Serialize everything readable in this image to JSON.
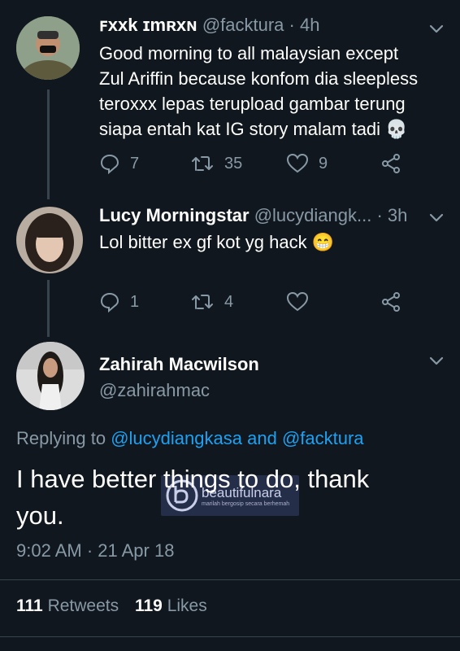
{
  "tweet1": {
    "display_name": "ꜰxxk ɪmʀxɴ",
    "handle": "@facktura",
    "time": "· 4h",
    "text_lines": [
      "Good morning to all malaysian except",
      "Zul Ariffin because konfom dia sleepless",
      "teroxxx lepas terupload gambar terung",
      "siapa entah kat IG story malam tadi 💀"
    ],
    "replies": "7",
    "retweets": "35",
    "likes": "9"
  },
  "tweet2": {
    "display_name": "Lucy Morningstar",
    "handle": "@lucydiangk...",
    "time": "· 3h",
    "text": "Lol bitter ex gf kot yg hack 😁",
    "replies": "1",
    "retweets": "4"
  },
  "main_tweet": {
    "display_name": "Zahirah Macwilson",
    "handle": "@zahirahmac",
    "replying_prefix": "Replying to",
    "reply_to_1": "@lucydiangkasa",
    "reply_and": "and",
    "reply_to_2": "@facktura",
    "text_line1": "I have better things to do, thank",
    "text_line2": "you.",
    "timestamp": "9:02 AM · 21 Apr 18",
    "retweet_count": "111",
    "retweet_label": "Retweets",
    "like_count": "119",
    "like_label": "Likes"
  },
  "watermark": {
    "brand": "beautifulnara",
    "tagline": "marilah bergosip secara berhemah"
  },
  "colors": {
    "background": "#10171e",
    "muted": "#8899a6",
    "accent": "#1da1f2",
    "divider": "#38444d"
  },
  "icons": [
    "reply-icon",
    "retweet-icon",
    "heart-icon",
    "share-icon",
    "chevron-down-icon"
  ]
}
